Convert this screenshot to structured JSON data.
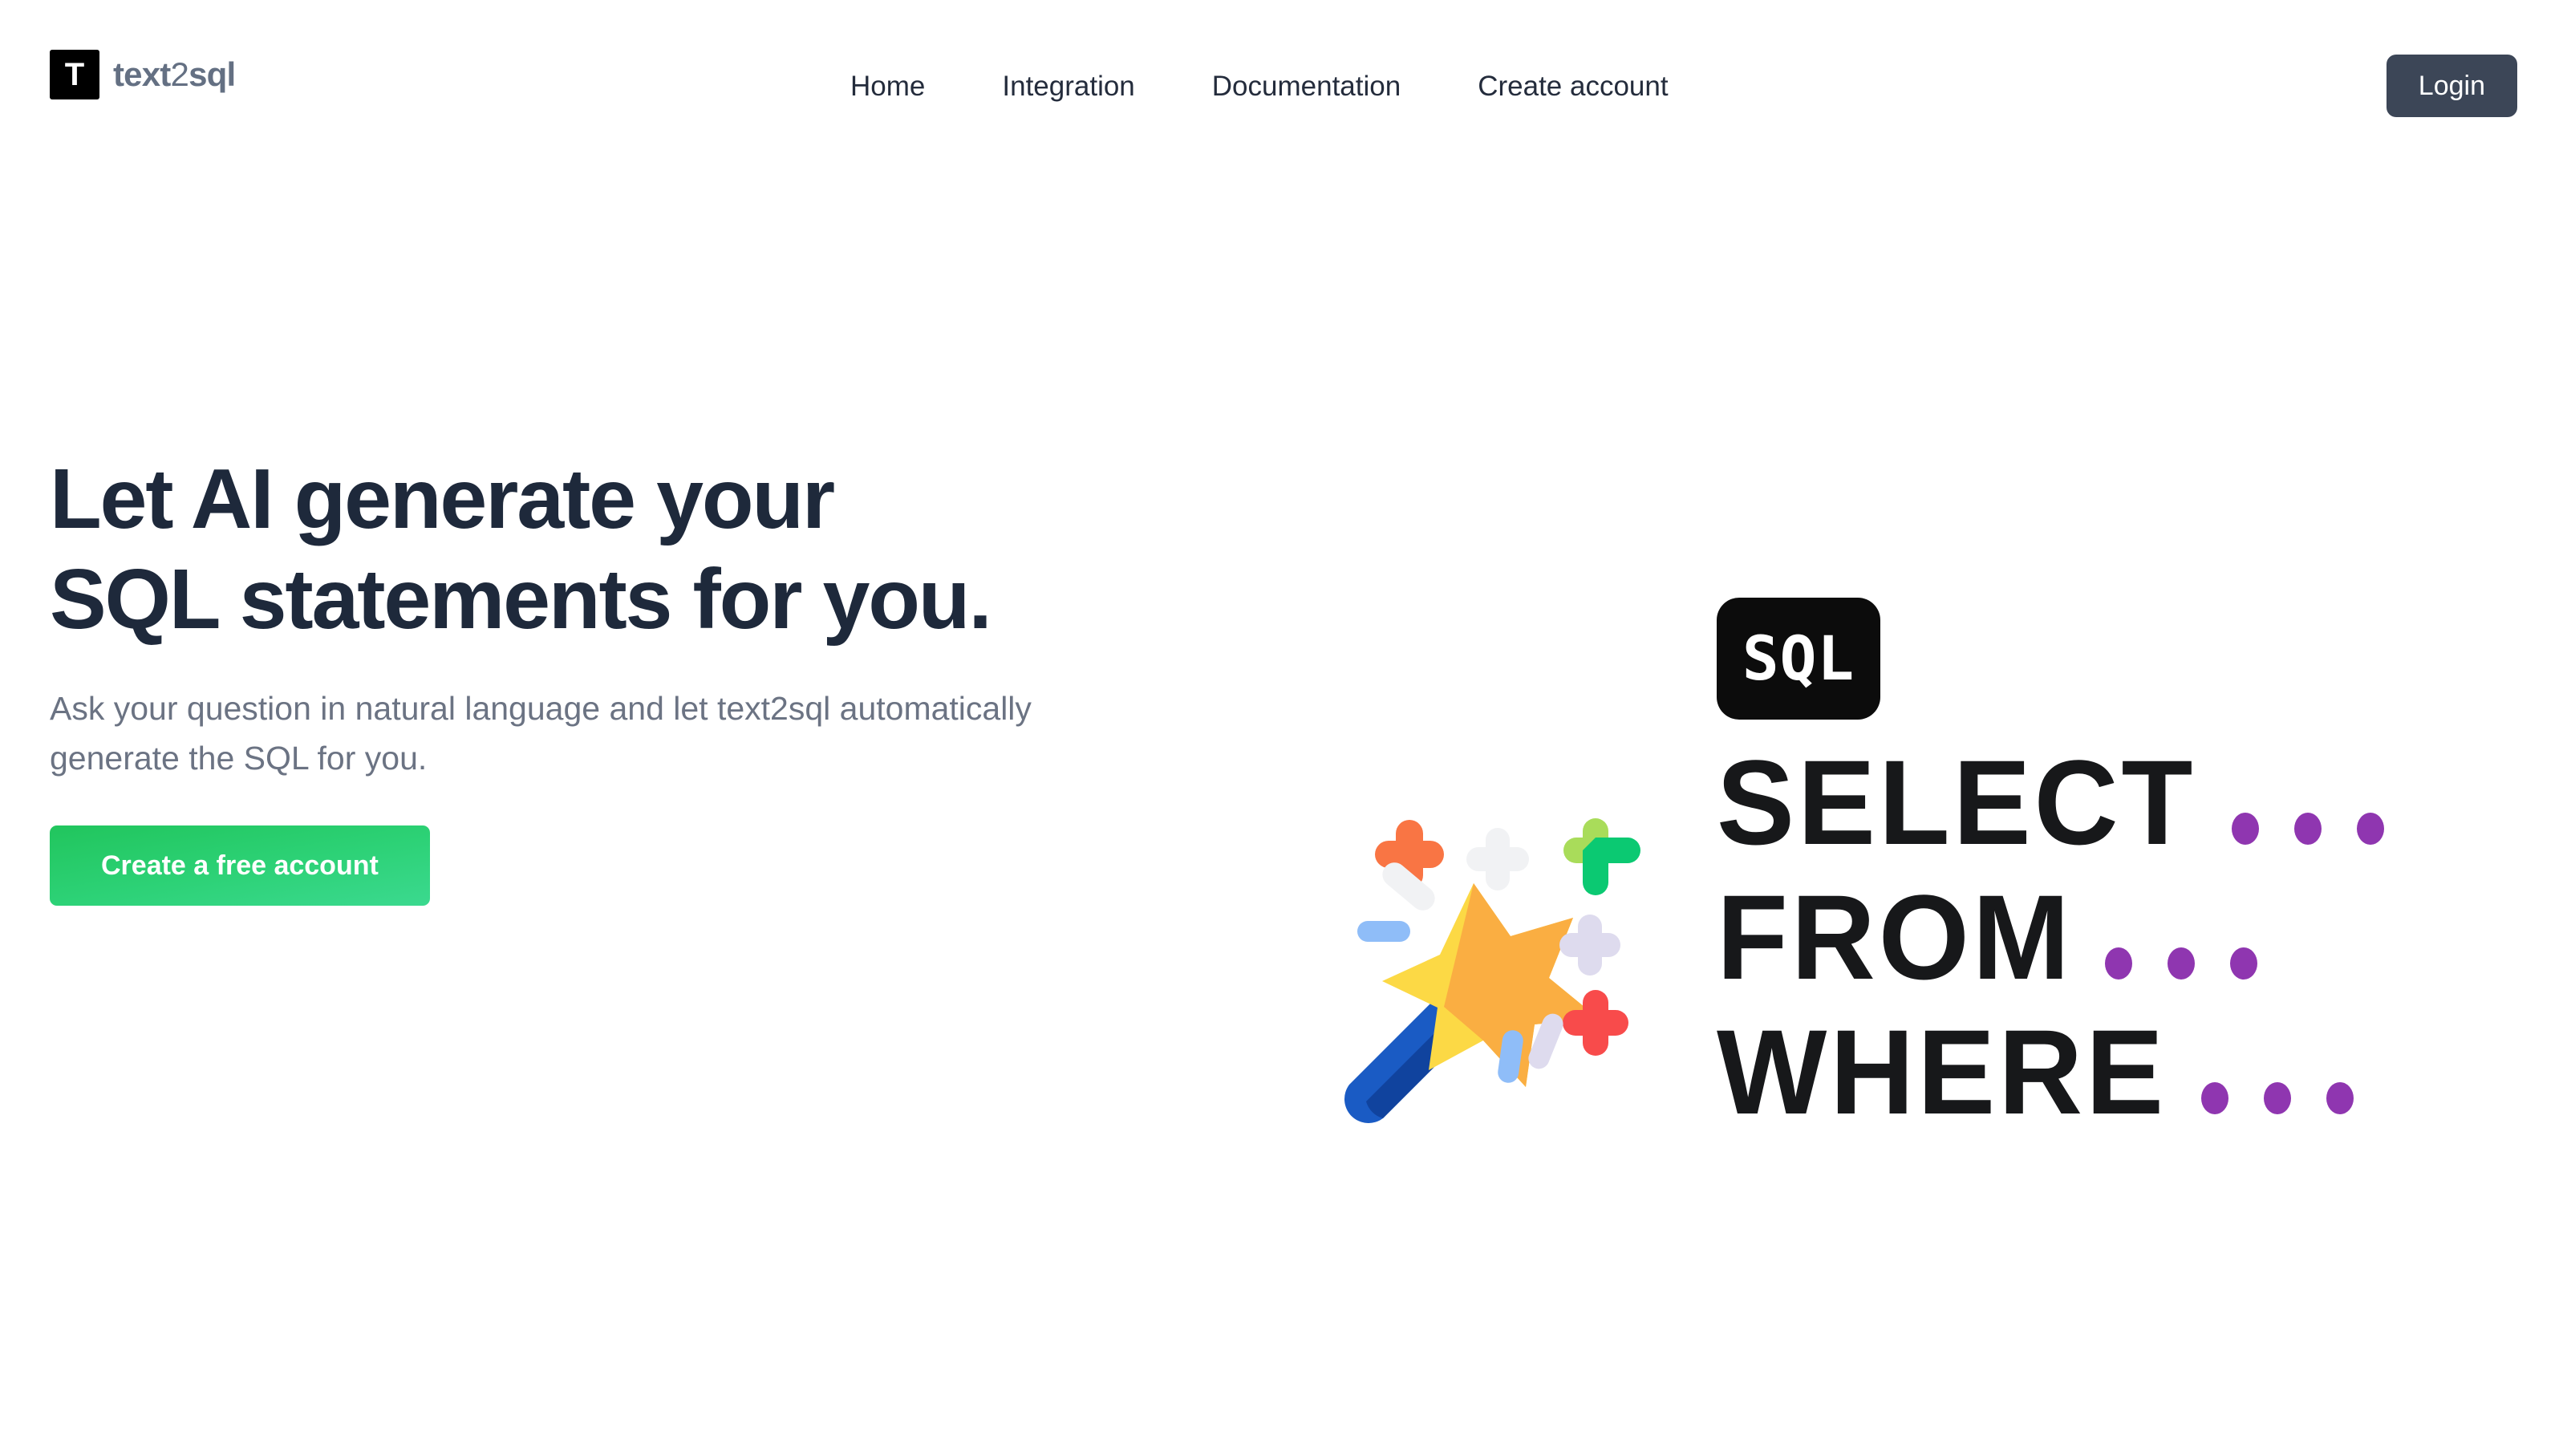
{
  "header": {
    "brand": {
      "mark_letter": "T",
      "name_bold_1": "text",
      "name_light": "2",
      "name_bold_2": "sql"
    },
    "nav": [
      {
        "label": "Home"
      },
      {
        "label": "Integration"
      },
      {
        "label": "Documentation"
      },
      {
        "label": "Create account"
      }
    ],
    "login_label": "Login"
  },
  "hero": {
    "headline": "Let AI generate your SQL statements for you.",
    "subhead": "Ask your question in natural language and let text2sql automatically generate the SQL for you.",
    "cta_label": "Create a free account"
  },
  "art": {
    "badge_label": "SQL",
    "keywords": [
      {
        "text": "SELECT",
        "dots": 3
      },
      {
        "text": "FROM",
        "dots": 3
      },
      {
        "text": "WHERE",
        "dots": 3
      }
    ],
    "wand_alt": "magic-wand-illustration"
  },
  "colors": {
    "accent_green_start": "#21c55e",
    "accent_green_end": "#3bd98f",
    "login_slate": "#3c4657",
    "headline_navy": "#1e293b",
    "body_gray": "#6b7383",
    "brand_gray": "#647083",
    "keyword_black": "#17181a",
    "dot_purple": "#8f36b0",
    "badge_black": "#0c0c0c"
  }
}
